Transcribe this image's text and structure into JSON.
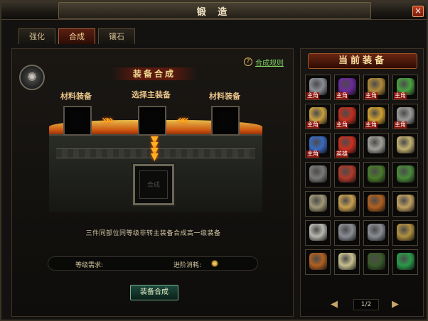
{
  "window": {
    "title": "锻 造",
    "close_icon": "×"
  },
  "tabs": [
    {
      "label": "强化",
      "active": false
    },
    {
      "label": "合成",
      "active": true
    },
    {
      "label": "镶石",
      "active": false
    }
  ],
  "forge": {
    "help_icon": "?",
    "help_link": "合成规则",
    "section_title": "装备合成",
    "material_label_left": "材料装备",
    "main_label": "选择主装备",
    "material_label_right": "材料装备",
    "arrows_right": "»»",
    "arrows_left": "««",
    "result_placeholder": "合成",
    "description": "三件同部位同等级非转主装备合成高一级装备",
    "requirement_label": "等级需求:",
    "cost_label": "进阶消耗:",
    "craft_button": "装备合成"
  },
  "inventory": {
    "title": "当前装备",
    "page": "1/2",
    "prev_icon": "◀",
    "next_icon": "▶",
    "items": [
      {
        "name": "helmet-icon",
        "color": "#8a8d94",
        "tag": "主角"
      },
      {
        "name": "purple-cloak-icon",
        "color": "#6a2a9a",
        "tag": "主角"
      },
      {
        "name": "horned-helmet-icon",
        "color": "#b08a3a",
        "tag": "主角"
      },
      {
        "name": "jade-ring-icon",
        "color": "#4aa040",
        "tag": "主角"
      },
      {
        "name": "gold-ring-icon",
        "color": "#c8a040",
        "tag": "主角"
      },
      {
        "name": "ruby-ring-icon",
        "color": "#c03020",
        "tag": "主角"
      },
      {
        "name": "gold-ring-red-icon",
        "color": "#d0a030",
        "tag": "主角"
      },
      {
        "name": "silver-bracer-icon",
        "color": "#9a9a98",
        "tag": "主角"
      },
      {
        "name": "blue-boots-icon",
        "color": "#3a6ac0",
        "tag": "主角"
      },
      {
        "name": "ruby-ring-icon",
        "color": "#c83020",
        "tag": "英雄"
      },
      {
        "name": "bracer-icon",
        "color": "#a0a098",
        "tag": ""
      },
      {
        "name": "armor-icon",
        "color": "#c0b070",
        "tag": ""
      },
      {
        "name": "bracelet-icon",
        "color": "#7a7a78",
        "tag": ""
      },
      {
        "name": "armor-red-icon",
        "color": "#b03a2a",
        "tag": ""
      },
      {
        "name": "green-helmet-icon",
        "color": "#4a7a2a",
        "tag": ""
      },
      {
        "name": "green-armor-icon",
        "color": "#4a8a3a",
        "tag": ""
      },
      {
        "name": "pants-icon",
        "color": "#a09878",
        "tag": ""
      },
      {
        "name": "gold-armor-icon",
        "color": "#c8a050",
        "tag": ""
      },
      {
        "name": "whip-icon",
        "color": "#b06020",
        "tag": ""
      },
      {
        "name": "spear-icon",
        "color": "#c0a060",
        "tag": ""
      },
      {
        "name": "sword-icon",
        "color": "#b8b8b0",
        "tag": ""
      },
      {
        "name": "helmet-icon",
        "color": "#8a8d94",
        "tag": ""
      },
      {
        "name": "helmet-icon",
        "color": "#8a8d94",
        "tag": ""
      },
      {
        "name": "gold-helmet-icon",
        "color": "#b09040",
        "tag": ""
      },
      {
        "name": "whip-icon",
        "color": "#b06020",
        "tag": ""
      },
      {
        "name": "staff-icon",
        "color": "#c8c090",
        "tag": ""
      },
      {
        "name": "dark-helmet-icon",
        "color": "#3a5a2a",
        "tag": ""
      },
      {
        "name": "jade-bangle-icon",
        "color": "#2a9a4a",
        "tag": ""
      }
    ]
  }
}
